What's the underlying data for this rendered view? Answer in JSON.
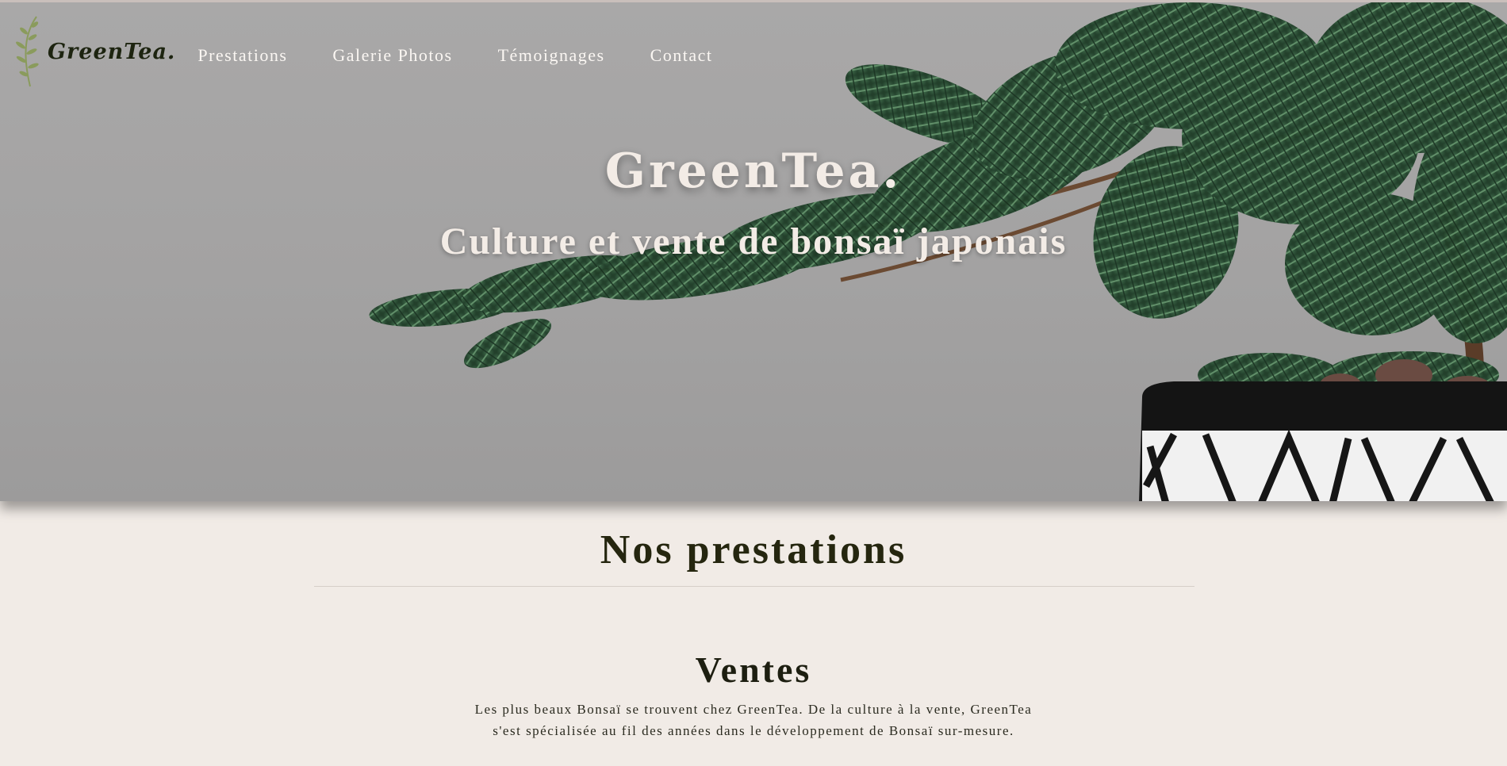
{
  "brand": {
    "logo_text": "GreenTea.",
    "accent_color": "#1d2410"
  },
  "nav": {
    "items": [
      {
        "label": "Prestations"
      },
      {
        "label": "Galerie Photos"
      },
      {
        "label": "Témoignages"
      },
      {
        "label": "Contact"
      }
    ]
  },
  "hero": {
    "title": "GreenTea.",
    "subtitle": "Culture et vente de bonsaï japonais",
    "image": "bonsai-photo"
  },
  "prestations": {
    "heading": "Nos prestations",
    "ventes": {
      "heading": "Ventes",
      "text": "Les plus beaux Bonsaï se trouvent chez GreenTea. De la culture à la vente, GreenTea s'est spécialisée au fil des années dans le développement de Bonsaï sur-mesure."
    }
  },
  "colors": {
    "background": "#f1ebe6",
    "hero_gray": "#a6a5a5",
    "foliage": "#2f5a3a",
    "text_dark": "#25260f"
  }
}
